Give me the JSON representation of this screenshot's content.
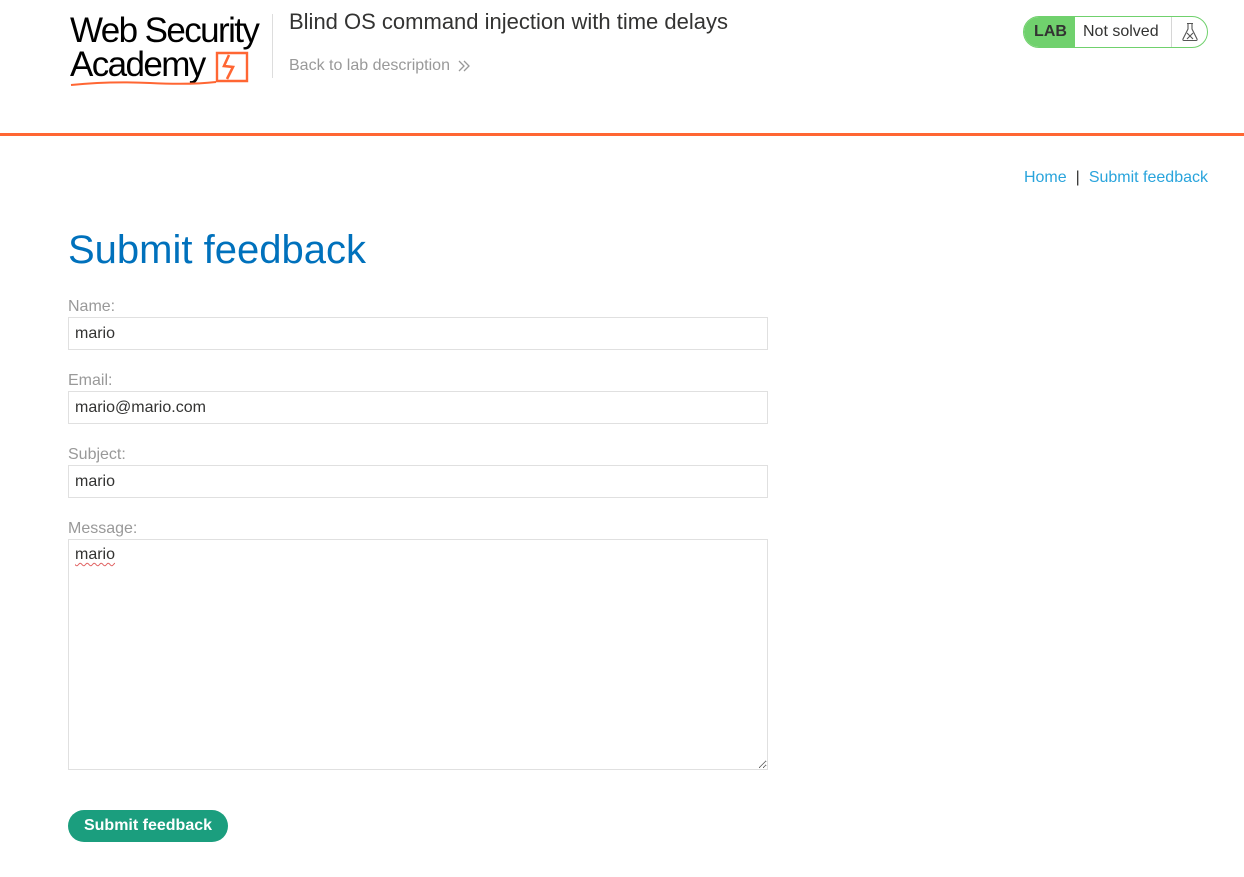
{
  "header": {
    "logo": {
      "line1": "Web Security",
      "line2": "Academy",
      "accent_color": "#ff6633"
    },
    "lab_title": "Blind OS command injection with time delays",
    "back_link_label": "Back to lab description",
    "back_link_icon": "double-chevron-right-icon",
    "status": {
      "badge": "LAB",
      "text": "Not solved",
      "icon": "flask-icon",
      "color": "#70d16d"
    },
    "border_color": "#ff6633"
  },
  "nav": {
    "home_label": "Home",
    "separator": "|",
    "feedback_label": "Submit feedback",
    "link_color": "#29a4dc"
  },
  "page": {
    "title": "Submit feedback",
    "title_color": "#0071bc"
  },
  "form": {
    "name": {
      "label": "Name:",
      "value": "mario"
    },
    "email": {
      "label": "Email:",
      "value": "mario@mario.com"
    },
    "subject": {
      "label": "Subject:",
      "value": "mario"
    },
    "message": {
      "label": "Message:",
      "value": "mario"
    },
    "submit_label": "Submit feedback",
    "submit_color": "#1b9e7e"
  }
}
